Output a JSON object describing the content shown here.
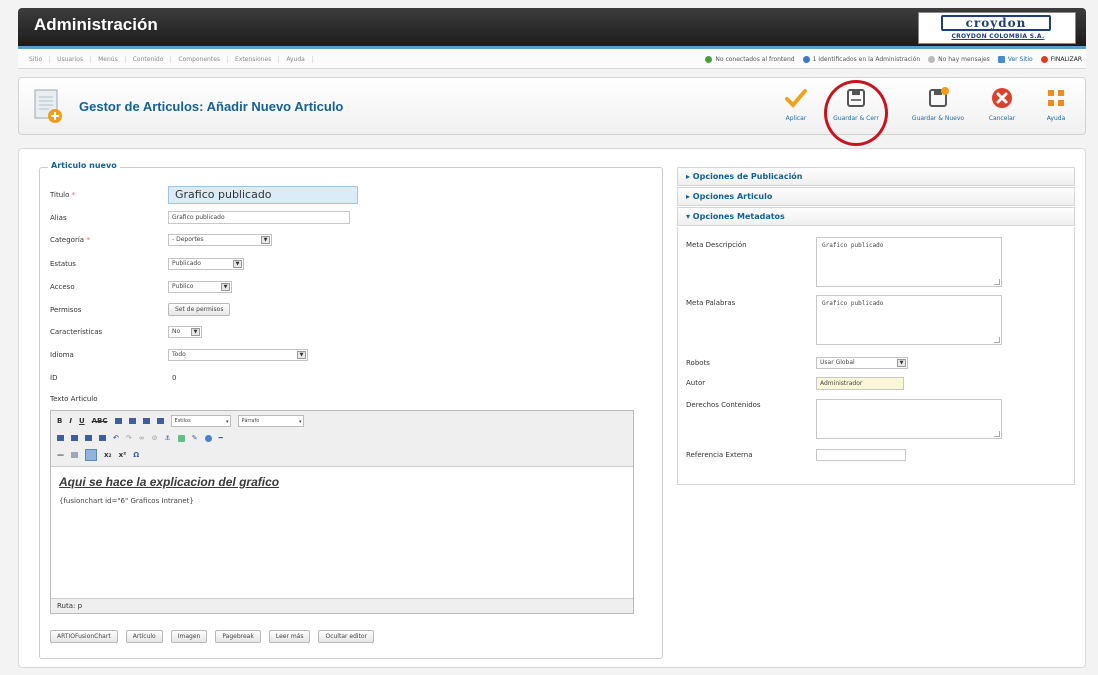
{
  "header": {
    "title": "Administración"
  },
  "brand": {
    "name": "croydon",
    "subtitle": "CROYDON COLOMBIA S.A."
  },
  "menu": [
    "Sitio",
    "Usuarios",
    "Menús",
    "Contenido",
    "Componentes",
    "Extensiones",
    "Ayuda"
  ],
  "status": {
    "frontend": "No conectados al frontend",
    "admin": "1 Identificados en la Administración",
    "messages": "No hay mensajes",
    "site": "Ver Sitio",
    "logout": "FINALIZAR"
  },
  "page_title": "Gestor de Articulos: Añadir Nuevo Articulo",
  "toolbar": {
    "apply": "Aplicar",
    "save_close": "Guardar & Cerr",
    "save_new": "Guardar & Nuevo",
    "cancel": "Cancelar",
    "help": "Ayuda"
  },
  "form": {
    "legend": "Articulo nuevo",
    "title_label": "Titulo",
    "title_value": "Grafico publicado",
    "alias_label": "Alias",
    "alias_value": "Grafico publicado",
    "category_label": "Categoría",
    "category_value": "- Deportes",
    "status_label": "Estatus",
    "status_value": "Publicado",
    "access_label": "Acceso",
    "access_value": "Publico",
    "permissions_label": "Permisos",
    "permissions_button": "Set de permisos",
    "featured_label": "Características",
    "featured_value": "No",
    "language_label": "Idioma",
    "language_value": "Todo",
    "id_label": "ID",
    "id_value": "0",
    "text_label": "Texto Articulo"
  },
  "editor": {
    "style_combo": "Estilos",
    "format_combo": "Párrafo",
    "heading": "Aqui se hace la explicacion del grafico",
    "body": "{fusionchart id=\"6\" Graficos Intranet}",
    "path": "Ruta: p",
    "buttons": [
      "ARTIOFusionChart",
      "Artículo",
      "Imagen",
      "Pagebreak",
      "Leer más",
      "Ocultar editor"
    ]
  },
  "accordion": {
    "publishing": "▸ Opciones de Publicación",
    "article": "▸ Opciones Articulo",
    "metadata": "▾ Opciones Metadatos"
  },
  "metadata": {
    "desc_label": "Meta Descripción",
    "desc_value": "Grafico publicado",
    "keywords_label": "Meta Palabras",
    "keywords_value": "Grafico publicado",
    "robots_label": "Robots",
    "robots_value": "Usar Global",
    "author_label": "Autor",
    "author_value": "Administrador",
    "rights_label": "Derechos Contenidos",
    "rights_value": "",
    "xref_label": "Referencia Externa",
    "xref_value": ""
  },
  "colors": {
    "accent": "#146295",
    "highlight_circle": "#c9141f"
  }
}
